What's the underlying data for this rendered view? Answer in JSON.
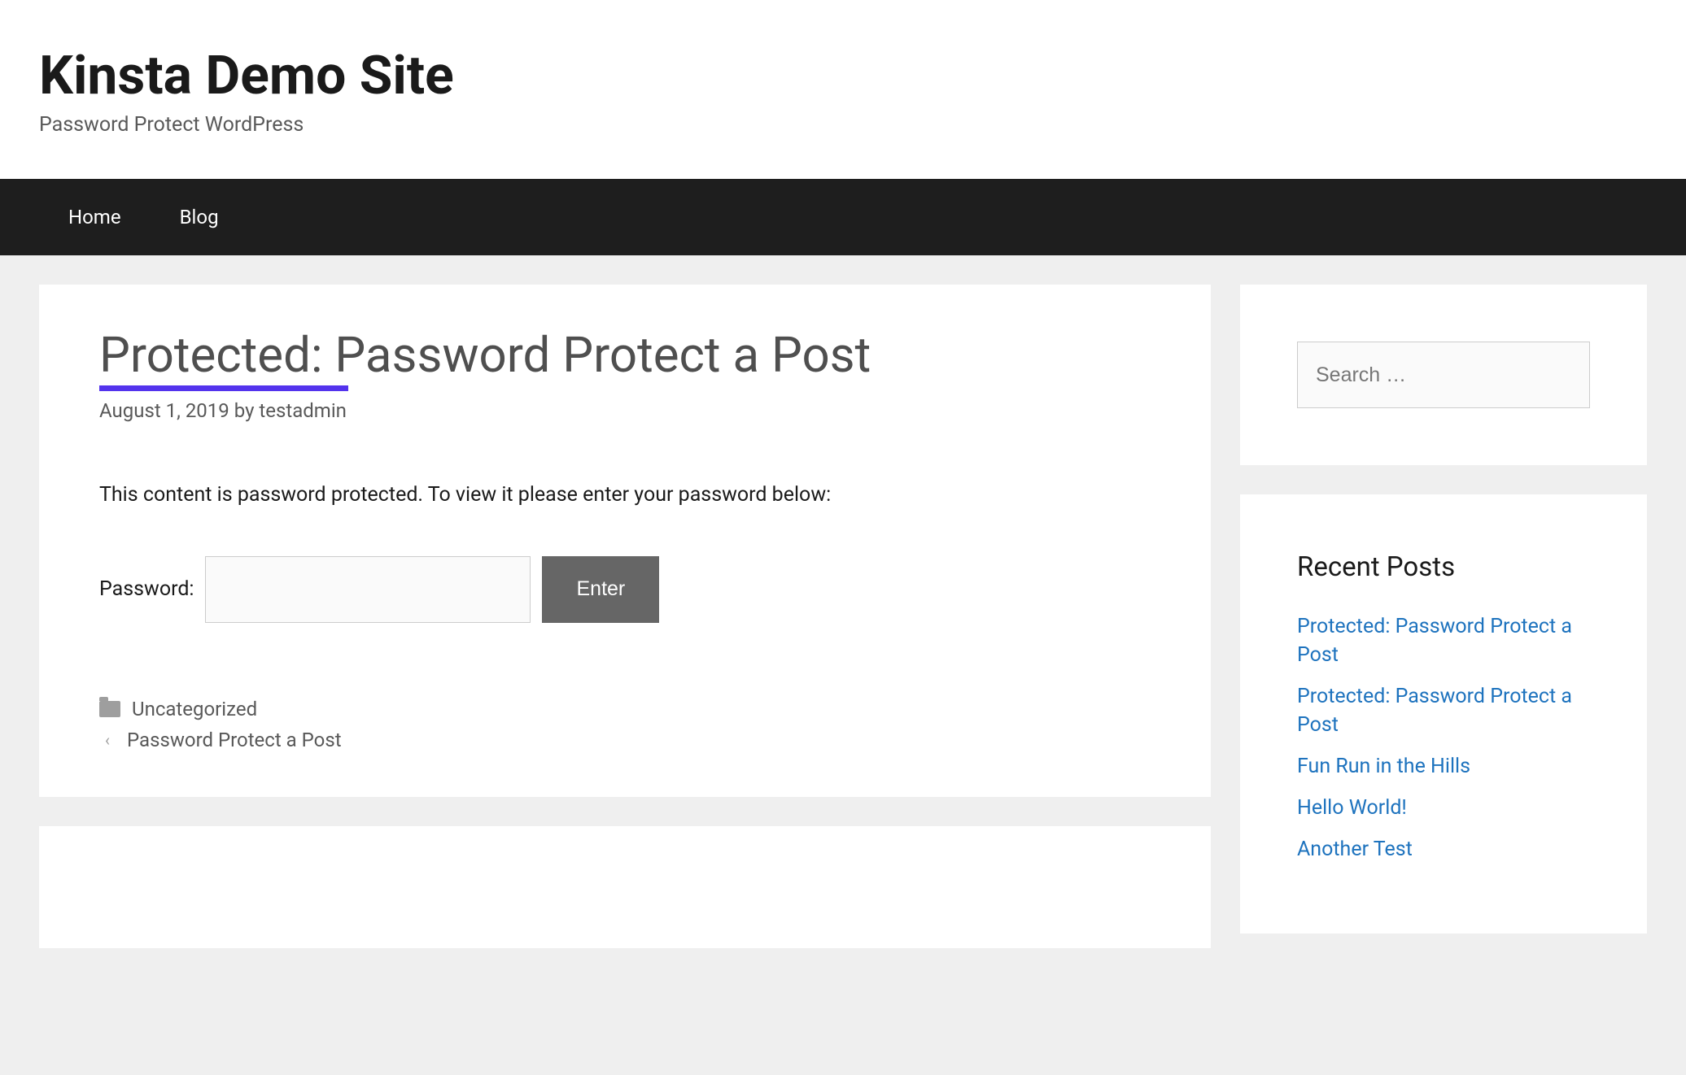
{
  "header": {
    "site_title": "Kinsta Demo Site",
    "site_description": "Password Protect WordPress"
  },
  "nav": {
    "items": [
      {
        "label": "Home"
      },
      {
        "label": "Blog"
      }
    ]
  },
  "post": {
    "title": "Protected: Password Protect a Post",
    "date": "August 1, 2019",
    "byline_prefix": "by",
    "author": "testadmin",
    "body": "This content is password protected. To view it please enter your password below:",
    "password_label": "Password:",
    "enter_label": "Enter",
    "category": "Uncategorized",
    "prev_link": "Password Protect a Post"
  },
  "sidebar": {
    "search_placeholder": "Search …",
    "recent_title": "Recent Posts",
    "recent_posts": [
      "Protected: Password Protect a Post",
      "Protected: Password Protect a Post",
      "Fun Run in the Hills",
      "Hello World!",
      "Another Test"
    ]
  }
}
